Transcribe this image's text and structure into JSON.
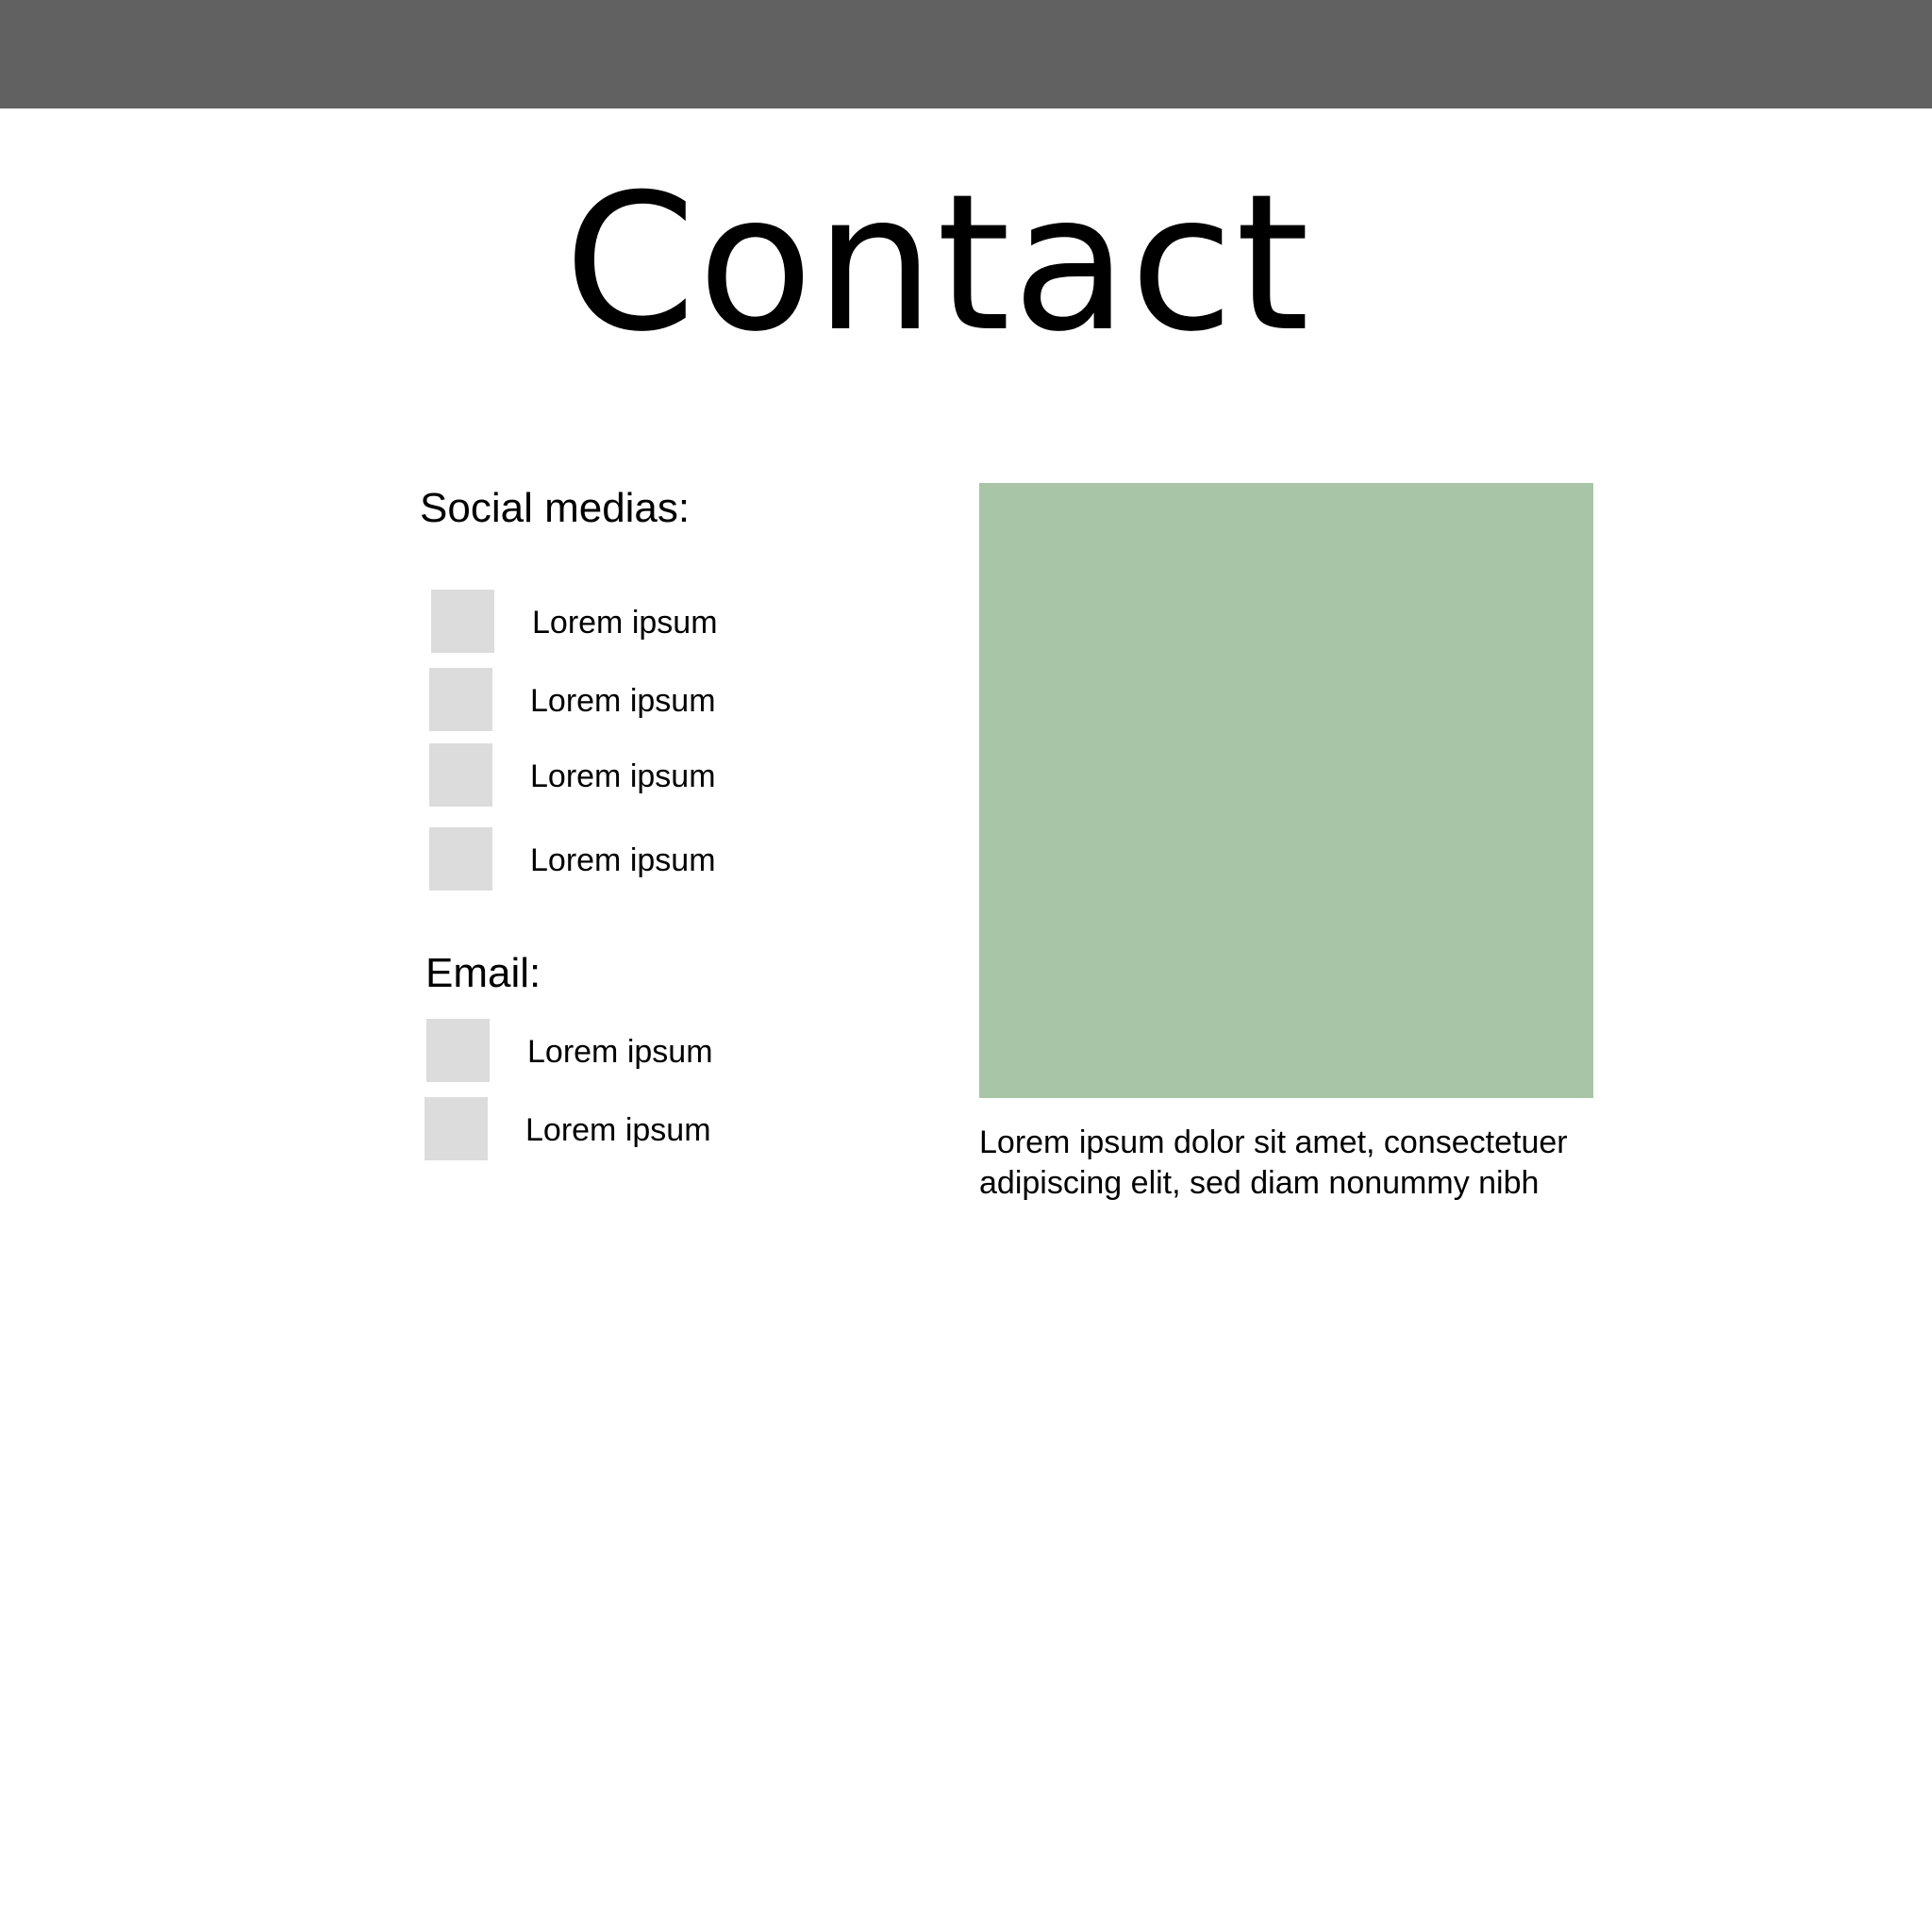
{
  "colors": {
    "top_bar": "#616161",
    "item_box": "#dcdcdc",
    "image_placeholder": "#a8c5a8",
    "text": "#000000",
    "background": "#ffffff"
  },
  "page": {
    "title": "Contact"
  },
  "social": {
    "heading": "Social medias:",
    "items": [
      {
        "label": "Lorem ipsum"
      },
      {
        "label": "Lorem ipsum"
      },
      {
        "label": "Lorem ipsum"
      },
      {
        "label": "Lorem ipsum"
      }
    ]
  },
  "email": {
    "heading": "Email:",
    "items": [
      {
        "label": "Lorem ipsum"
      },
      {
        "label": "Lorem ipsum"
      }
    ]
  },
  "media": {
    "caption": "Lorem ipsum dolor sit amet, consectetuer adipiscing elit, sed diam nonummy nibh"
  }
}
